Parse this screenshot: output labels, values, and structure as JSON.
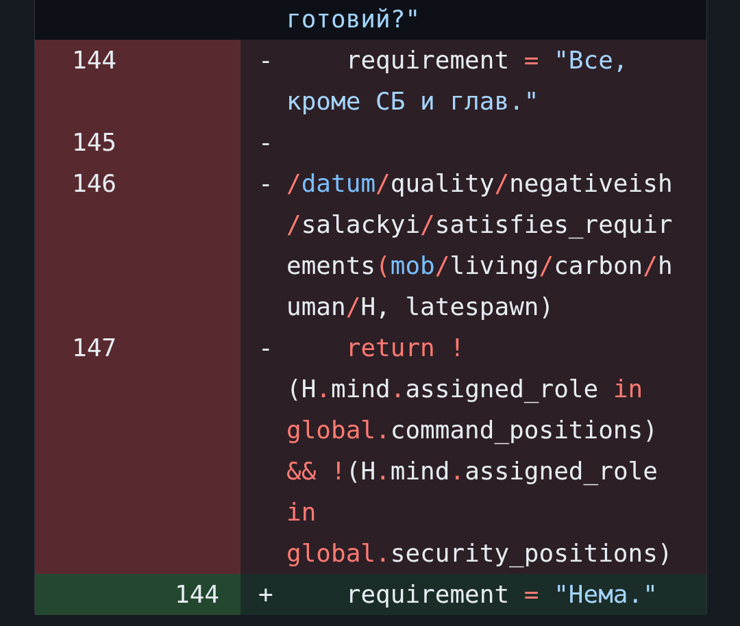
{
  "diff_lines": [
    {
      "kind": "context",
      "tokens": [
        {
          "kind": "string",
          "t": "готовий?\""
        }
      ]
    },
    {
      "kind": "deleted",
      "old_number": "144",
      "marker": "-",
      "tokens": [
        {
          "kind": "text",
          "t": "    requirement "
        },
        {
          "kind": "keyword",
          "t": "="
        },
        {
          "kind": "string",
          "t": " \"Все, кроме СБ и глав.\""
        }
      ]
    },
    {
      "kind": "deleted",
      "old_number": "145",
      "marker": "-"
    },
    {
      "kind": "deleted",
      "old_number": "146",
      "marker": "-",
      "tokens": [
        {
          "kind": "keyword",
          "t": "/"
        },
        {
          "kind": "entity",
          "t": "datum"
        },
        {
          "kind": "keyword",
          "t": "/"
        },
        {
          "kind": "text",
          "t": "quality"
        },
        {
          "kind": "keyword",
          "t": "/"
        },
        {
          "kind": "text",
          "t": "negativeish"
        },
        {
          "kind": "keyword",
          "t": "/"
        },
        {
          "kind": "text",
          "t": "salackyi"
        },
        {
          "kind": "keyword",
          "t": "/"
        },
        {
          "kind": "text",
          "t": "satisfies_requirements"
        },
        {
          "kind": "keyword",
          "t": "("
        },
        {
          "kind": "entity",
          "t": "mob"
        },
        {
          "kind": "keyword",
          "t": "/"
        },
        {
          "kind": "text",
          "t": "living"
        },
        {
          "kind": "keyword",
          "t": "/"
        },
        {
          "kind": "text",
          "t": "carbon"
        },
        {
          "kind": "keyword",
          "t": "/"
        },
        {
          "kind": "text",
          "t": "human"
        },
        {
          "kind": "keyword",
          "t": "/"
        },
        {
          "kind": "text",
          "t": "H, latespawn)"
        }
      ]
    },
    {
      "kind": "deleted",
      "old_number": "147",
      "marker": "-",
      "tokens": [
        {
          "kind": "keyword",
          "t": "    return !"
        },
        {
          "kind": "text",
          "t": "(H"
        },
        {
          "kind": "keyword",
          "t": "."
        },
        {
          "kind": "text",
          "t": "mind"
        },
        {
          "kind": "keyword",
          "t": "."
        },
        {
          "kind": "text",
          "t": "assigned_role "
        },
        {
          "kind": "keyword",
          "t": "in global."
        },
        {
          "kind": "text",
          "t": "command_positions) "
        },
        {
          "kind": "keyword",
          "t": "&& !"
        },
        {
          "kind": "text",
          "t": "(H"
        },
        {
          "kind": "keyword",
          "t": "."
        },
        {
          "kind": "text",
          "t": "mind"
        },
        {
          "kind": "keyword",
          "t": "."
        },
        {
          "kind": "text",
          "t": "assigned_role "
        },
        {
          "kind": "keyword",
          "t": "in global."
        },
        {
          "kind": "text",
          "t": "security_positions)"
        }
      ]
    },
    {
      "kind": "added",
      "new_number": "144",
      "marker": "+",
      "tokens": [
        {
          "kind": "text",
          "t": "    requirement "
        },
        {
          "kind": "keyword",
          "t": "="
        },
        {
          "kind": "string",
          "t": " \"Нема.\""
        }
      ]
    }
  ]
}
